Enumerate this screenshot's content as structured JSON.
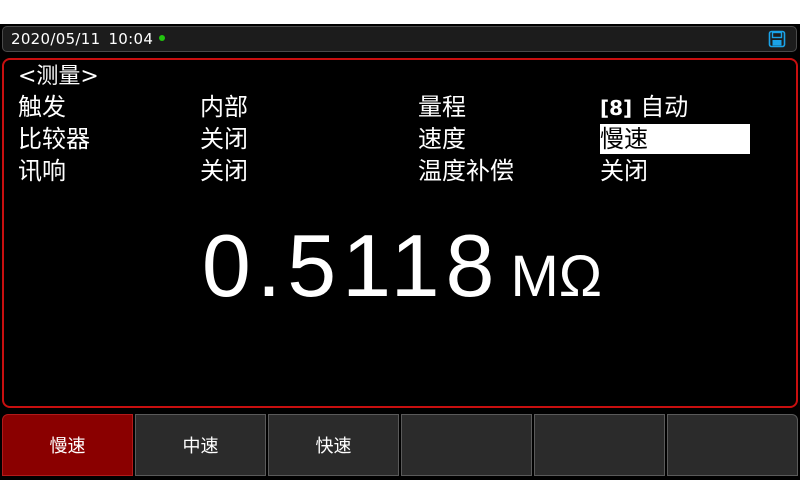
{
  "status_bar": {
    "date": "2020/05/11",
    "time": "10:04",
    "indicator_color": "#22c40f",
    "save_icon": "floppy-disk-icon"
  },
  "panel": {
    "title": "<测量>",
    "fields": {
      "trigger_label": "触发",
      "trigger_value": "内部",
      "range_label": "量程",
      "range_tag": "[8]",
      "range_value": "自动",
      "compare_label": "比较器",
      "compare_value": "关闭",
      "speed_label": "速度",
      "speed_value": "慢速",
      "beep_label": "讯响",
      "beep_value": "关闭",
      "temp_comp_label": "温度补偿",
      "temp_comp_value": "关闭"
    },
    "reading": {
      "value": "0.5118",
      "unit": "MΩ"
    },
    "border_color": "#c80f0f"
  },
  "softkeys": [
    {
      "label": "慢速",
      "active": true
    },
    {
      "label": "中速",
      "active": false
    },
    {
      "label": "快速",
      "active": false
    },
    {
      "label": "",
      "active": false
    },
    {
      "label": "",
      "active": false
    },
    {
      "label": "",
      "active": false
    }
  ],
  "colors": {
    "active_key": "#8a0000",
    "key_bg": "#2b2b2b"
  }
}
